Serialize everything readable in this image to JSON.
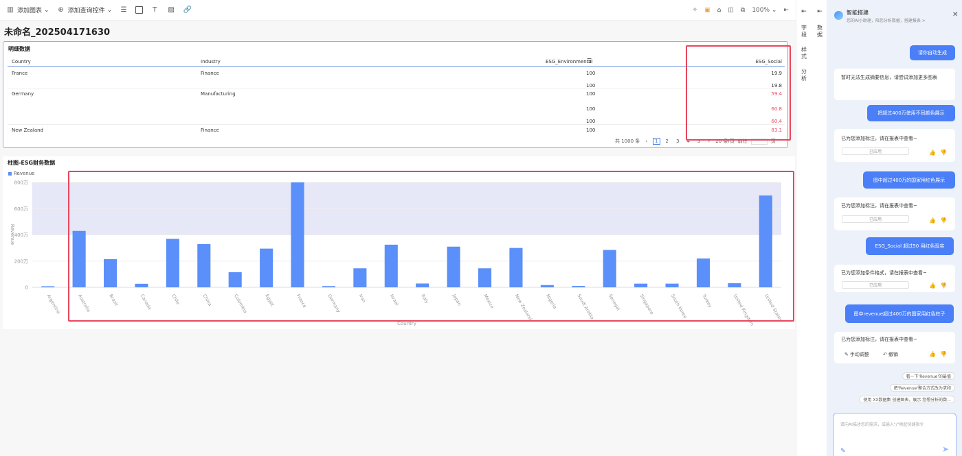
{
  "toolbar": {
    "add_chart": "添加图表",
    "add_query": "添加查询控件",
    "zoom": "100%"
  },
  "page": {
    "title": "未命名_202504171630"
  },
  "detail_table": {
    "title": "明细数据",
    "columns": [
      "Country",
      "Industry",
      "ESG_Environmental",
      "ESG_Social"
    ],
    "rows": [
      {
        "country": "France",
        "industry": "Finance",
        "env": "100",
        "social": "19.9",
        "highlight": false
      },
      {
        "country": "",
        "industry": "",
        "env": "100",
        "social": "19.8",
        "highlight": false
      },
      {
        "country": "Germany",
        "industry": "Manufacturing",
        "env": "100",
        "social": "59.4",
        "highlight": true
      },
      {
        "country": "",
        "industry": "",
        "env": "100",
        "social": "60.8",
        "highlight": true
      },
      {
        "country": "",
        "industry": "",
        "env": "100",
        "social": "60.4",
        "highlight": true
      },
      {
        "country": "New Zealand",
        "industry": "Finance",
        "env": "100",
        "social": "83.1",
        "highlight": true
      }
    ],
    "pager": {
      "total": "共 1000 条",
      "pages": [
        "1",
        "2",
        "3",
        "4",
        "5"
      ],
      "page_size": "20 条/页",
      "goto": "前往",
      "goto_suffix": "页"
    }
  },
  "chart_section": {
    "title": "柱图-ESG财务数据",
    "legend": "Revenue"
  },
  "chart_data": {
    "type": "bar",
    "xlabel": "Country",
    "ylabel": "Revenue",
    "ylim": [
      0,
      8000000
    ],
    "yticks": [
      "0",
      "200万",
      "400万",
      "600万",
      "800万"
    ],
    "highlight_band": [
      4000000,
      8000000
    ],
    "bar_color": "#5b8ff9",
    "band_color": "#e6e7f7",
    "categories": [
      "Argentina",
      "Australia",
      "Brazil",
      "Canada",
      "Chile",
      "China",
      "Colombia",
      "Egypt",
      "France",
      "Germany",
      "Iran",
      "Israel",
      "Italy",
      "Japan",
      "Mexico",
      "New Zealand",
      "Nigeria",
      "Saudi Arabia",
      "Senegal",
      "Singapore",
      "South Korea",
      "Turkey",
      "United Kingdom",
      "United States"
    ],
    "values": [
      80000,
      4300000,
      2150000,
      270000,
      3700000,
      3300000,
      1150000,
      2950000,
      8000000,
      90000,
      1450000,
      3250000,
      290000,
      3100000,
      1450000,
      3000000,
      170000,
      100000,
      2850000,
      280000,
      280000,
      2200000,
      310000,
      7000000
    ]
  },
  "side_tabs": [
    "字段",
    "数据",
    "样式",
    "分析"
  ],
  "assistant": {
    "title": "智能搭建",
    "subtitle": "您的AI小助理，陪您分析数据，搭建报表 >",
    "applied_label": "已应用",
    "messages": [
      {
        "role": "user",
        "text": "请你自动生成"
      },
      {
        "role": "ai",
        "text": "暂时无法生成摘要信息，请尝试添加更多图表"
      },
      {
        "role": "user",
        "text": "把超过400万使用不同颜色展示"
      },
      {
        "role": "ai",
        "text": "已为您添加标注，请在报表中查看~"
      },
      {
        "role": "user",
        "text": "图中超过400万的国家用红色展示"
      },
      {
        "role": "ai",
        "text": "已为您添加标注，请在报表中查看~"
      },
      {
        "role": "user",
        "text": "ESG_Social 超过50 用红色现实"
      },
      {
        "role": "ai",
        "text": "已为您添加条件格式，请在报表中查看~"
      },
      {
        "role": "user",
        "text": "图中revenue超过400万的国家用红色柱子"
      },
      {
        "role": "ai",
        "text": "已为您添加标注，请在报表中查看~"
      }
    ],
    "actions": {
      "adjust": "手动调整",
      "undo": "撤销"
    },
    "suggestions": [
      "看一下'Revenue'的最值",
      "把'Revenue'聚合方式改为求和",
      "使用 XX数据集 创建图表，展示 您想分析的数..."
    ],
    "input_placeholder": "请向AI描述您的需求，或输入\"/\"唤起快捷指令"
  },
  "colors": {
    "accent": "#4a7ff7",
    "highlight_red": "#e8465d"
  }
}
